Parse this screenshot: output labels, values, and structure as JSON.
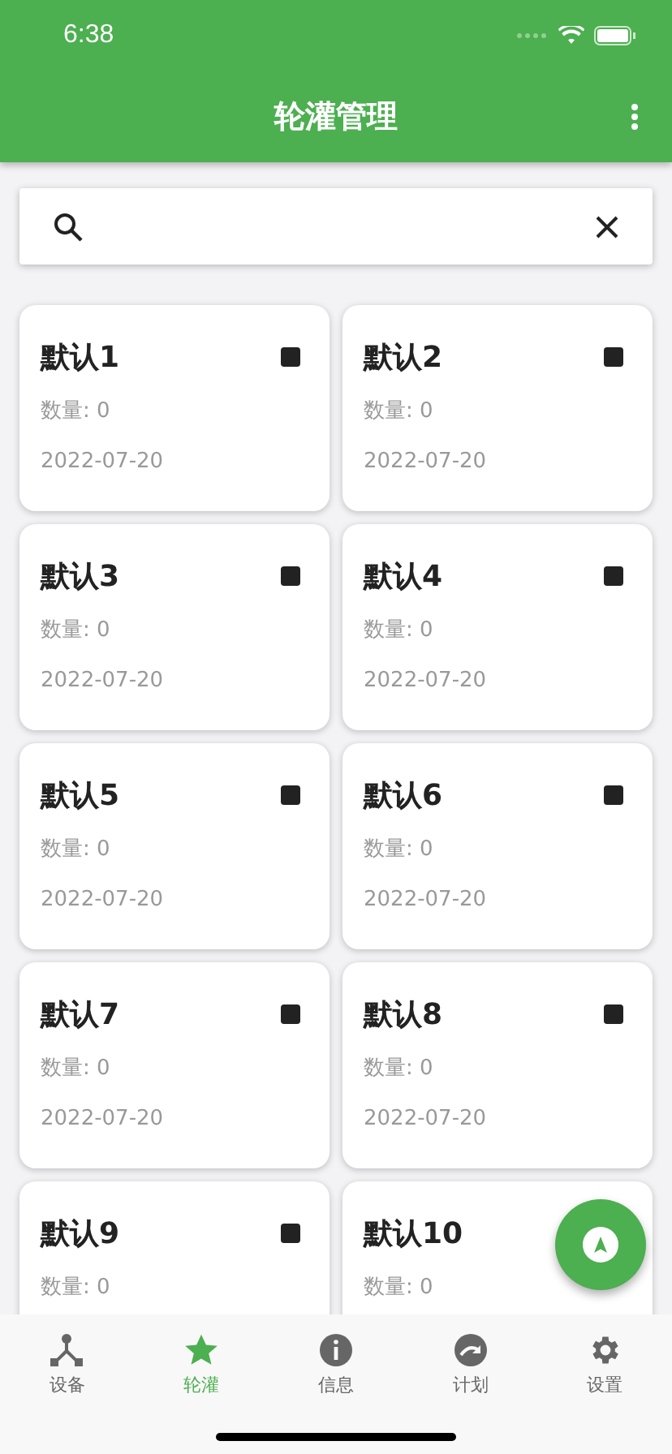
{
  "status_bar": {
    "time": "6:38"
  },
  "header": {
    "title": "轮灌管理"
  },
  "cards": [
    {
      "name": "默认1",
      "count": "数量: 0",
      "date": "2022-07-20",
      "stop_button": true
    },
    {
      "name": "默认2",
      "count": "数量: 0",
      "date": "2022-07-20",
      "stop_button": true
    },
    {
      "name": "默认3",
      "count": "数量: 0",
      "date": "2022-07-20",
      "stop_button": true
    },
    {
      "name": "默认4",
      "count": "数量: 0",
      "date": "2022-07-20",
      "stop_button": true
    },
    {
      "name": "默认5",
      "count": "数量: 0",
      "date": "2022-07-20",
      "stop_button": true
    },
    {
      "name": "默认6",
      "count": "数量: 0",
      "date": "2022-07-20",
      "stop_button": true
    },
    {
      "name": "默认7",
      "count": "数量: 0",
      "date": "2022-07-20",
      "stop_button": true
    },
    {
      "name": "默认8",
      "count": "数量: 0",
      "date": "2022-07-20",
      "stop_button": true
    },
    {
      "name": "默认9",
      "count": "数量: 0",
      "stop_button": true
    },
    {
      "name": "默认10",
      "count": "数量: 0",
      "stop_button": false
    }
  ],
  "tabs": [
    {
      "label": "设备",
      "kind": "network",
      "selected": false
    },
    {
      "label": "轮灌",
      "kind": "star",
      "selected": true
    },
    {
      "label": "信息",
      "kind": "info",
      "selected": false
    },
    {
      "label": "计划",
      "kind": "redo",
      "selected": false
    },
    {
      "label": "设置",
      "kind": "gear",
      "selected": false
    }
  ]
}
